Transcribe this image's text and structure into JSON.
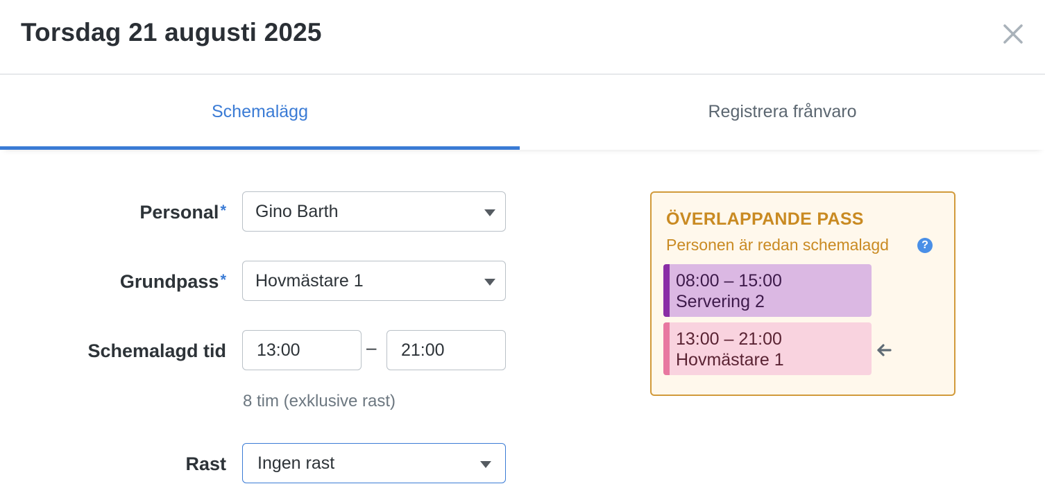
{
  "header": {
    "title": "Torsdag 21 augusti 2025"
  },
  "tabs": [
    {
      "label": "Schemalägg",
      "active": true
    },
    {
      "label": "Registrera frånvaro",
      "active": false
    }
  ],
  "form": {
    "personal": {
      "label": "Personal",
      "required_mark": "*",
      "value": "Gino Barth"
    },
    "grundpass": {
      "label": "Grundpass",
      "required_mark": "*",
      "value": "Hovmästare 1"
    },
    "schemalagd_tid": {
      "label": "Schemalagd tid",
      "start": "13:00",
      "separator": "–",
      "end": "21:00",
      "hint": "8 tim (exklusive rast)"
    },
    "rast": {
      "label": "Rast",
      "value": "Ingen rast"
    }
  },
  "overlap": {
    "title": "ÖVERLAPPANDE PASS",
    "subtitle": "Personen är redan schemalagd",
    "help_icon": "?",
    "shifts": [
      {
        "time": "08:00 – 15:00",
        "name": "Servering 2",
        "color": "#8a2ea6"
      },
      {
        "time": "13:00 – 21:00",
        "name": "Hovmästare 1",
        "color": "#e878a0",
        "current": true
      }
    ]
  },
  "colors": {
    "accent": "#3a7bd5",
    "warning": "#c98a22"
  },
  "icons": {
    "close": "close-icon",
    "help": "help-icon",
    "arrow": "arrow-left-icon",
    "caret": "chevron-down-icon"
  }
}
